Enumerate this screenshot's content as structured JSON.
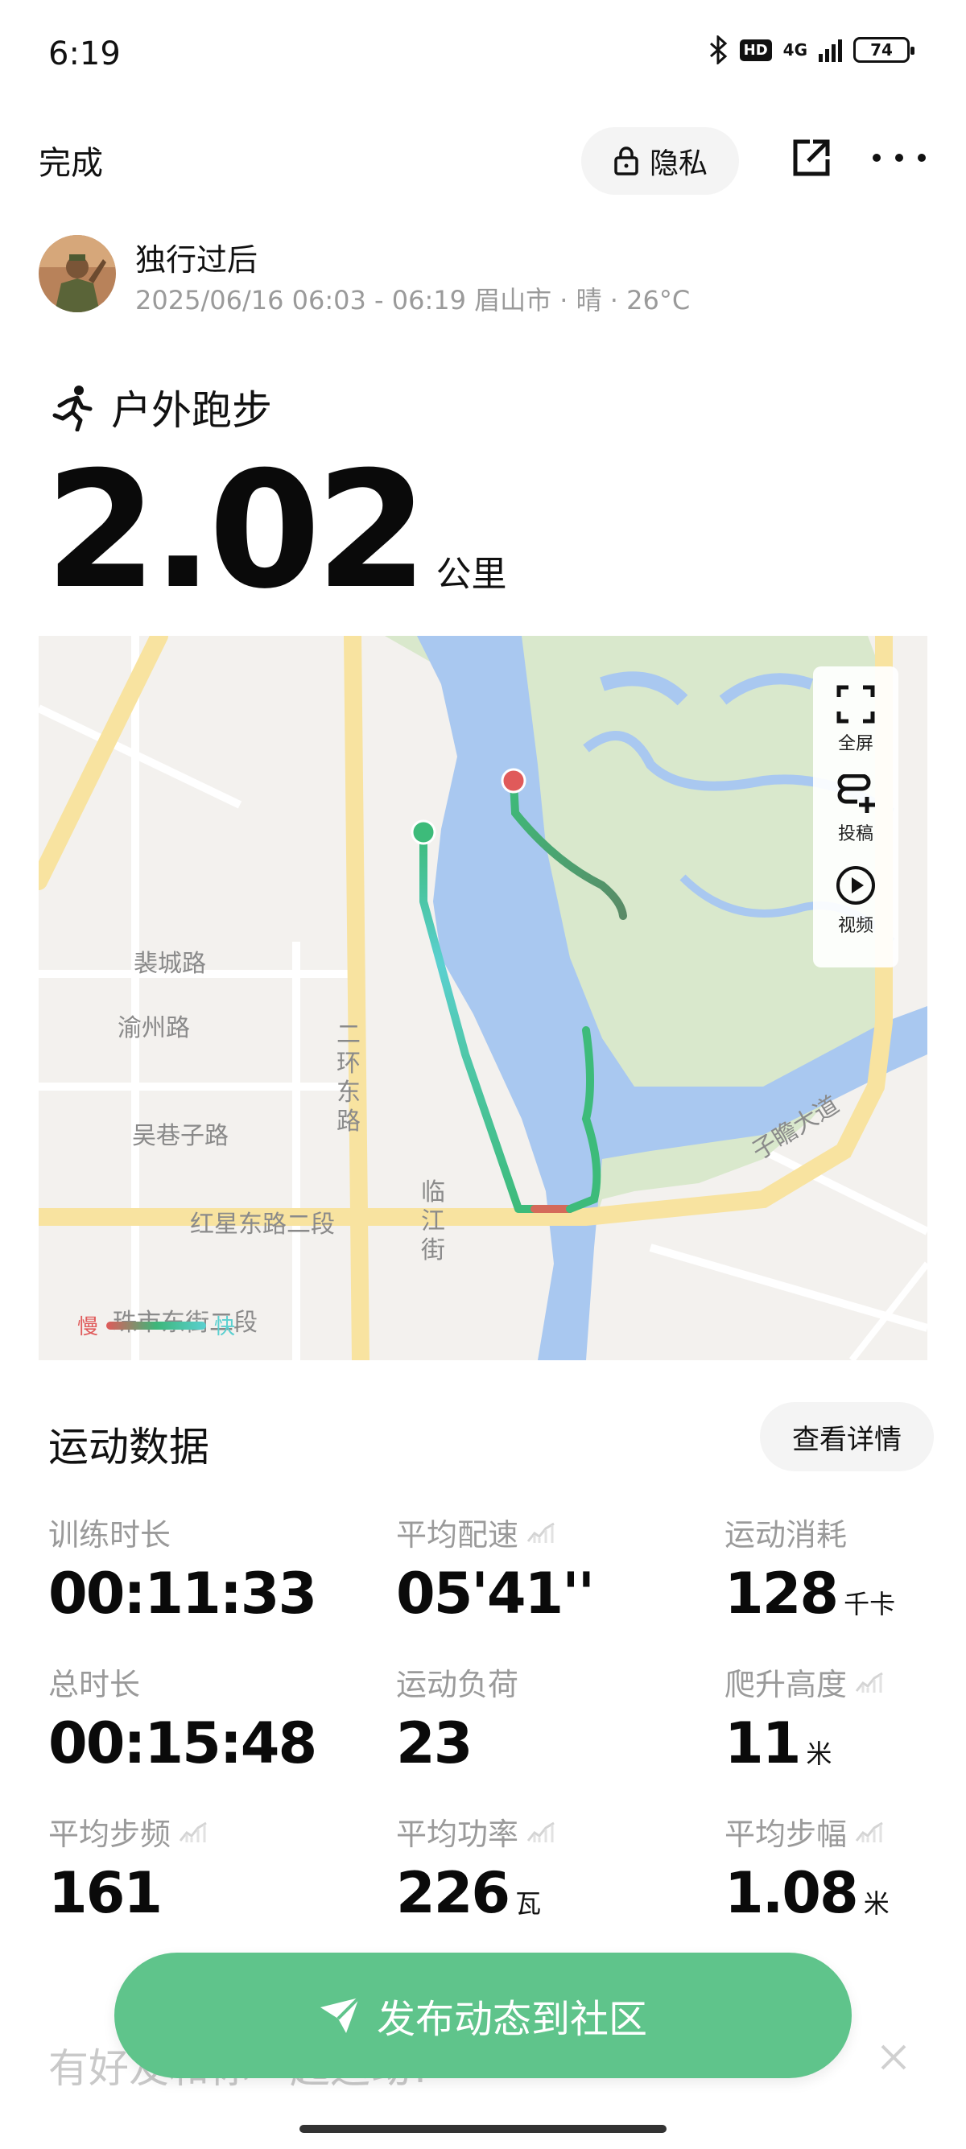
{
  "status_bar": {
    "time": "6:19",
    "hd": "HD",
    "network": "4G",
    "battery": "74"
  },
  "topbar": {
    "done_label": "完成",
    "privacy_label": "隐私"
  },
  "user": {
    "name": "独行过后",
    "meta": "2025/06/16 06:03 - 06:19 眉山市 · 晴 · 26°C"
  },
  "workout": {
    "type": "户外跑步",
    "distance": "2.02",
    "distance_unit": "公里"
  },
  "map": {
    "labels": {
      "peicheng": "裴城路",
      "yuzhou": "渝州路",
      "wuxiangzi": "吴巷子路",
      "erhuan": "二环东路",
      "hongxing": "红星东路二段",
      "linjiang": "临江街",
      "zhudong": "珠市东街二段",
      "zizhan": "子瞻大道"
    },
    "tools": {
      "fullscreen": "全屏",
      "post": "投稿",
      "video": "视频"
    },
    "legend": {
      "slow": "慢",
      "fast": "快"
    },
    "colors": {
      "water": "#a9c8f0",
      "park": "#d9e8cc",
      "road": "#f8e3a0",
      "start": "#3dbb7a",
      "end": "#e05a5a"
    }
  },
  "stats": {
    "title": "运动数据",
    "details_label": "查看详情",
    "items": [
      {
        "label": "训练时长",
        "value": "00:11:33",
        "unit": "",
        "trend": false
      },
      {
        "label": "平均配速",
        "value": "05'41''",
        "unit": "",
        "trend": true
      },
      {
        "label": "运动消耗",
        "value": "128",
        "unit": "千卡",
        "trend": false
      },
      {
        "label": "总时长",
        "value": "00:15:48",
        "unit": "",
        "trend": false
      },
      {
        "label": "运动负荷",
        "value": "23",
        "unit": "",
        "trend": false
      },
      {
        "label": "爬升高度",
        "value": "11",
        "unit": "米",
        "trend": true
      },
      {
        "label": "平均步频",
        "value": "161",
        "unit": "",
        "trend": true
      },
      {
        "label": "平均功率",
        "value": "226",
        "unit": "瓦",
        "trend": true
      },
      {
        "label": "平均步幅",
        "value": "1.08",
        "unit": "米",
        "trend": true
      }
    ]
  },
  "publish": {
    "label": "发布动态到社区"
  },
  "friend_hint": "有好友和你一起运动?",
  "colors": {
    "accent": "#5fc48b"
  }
}
